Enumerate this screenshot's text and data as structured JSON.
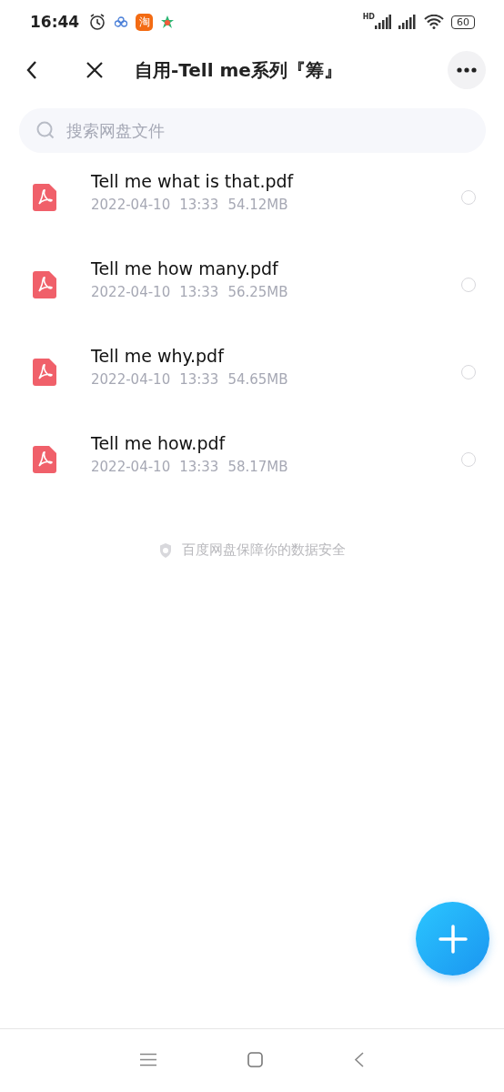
{
  "status_bar": {
    "time": "16:44",
    "app_badge": "淘",
    "network_label": "HD",
    "battery": "60"
  },
  "header": {
    "title": "自用-Tell me系列『筹』"
  },
  "search": {
    "placeholder": "搜索网盘文件"
  },
  "files": [
    {
      "name": "Tell me what is that.pdf",
      "date": "2022-04-10",
      "time": "13:33",
      "size": "54.12MB",
      "selected": false
    },
    {
      "name": "Tell me how many.pdf",
      "date": "2022-04-10",
      "time": "13:33",
      "size": "56.25MB",
      "selected": false
    },
    {
      "name": "Tell me why.pdf",
      "date": "2022-04-10",
      "time": "13:33",
      "size": "54.65MB",
      "selected": false
    },
    {
      "name": "Tell me how.pdf",
      "date": "2022-04-10",
      "time": "13:33",
      "size": "58.17MB",
      "selected": false
    }
  ],
  "footer_note": "百度网盘保障你的数据安全"
}
